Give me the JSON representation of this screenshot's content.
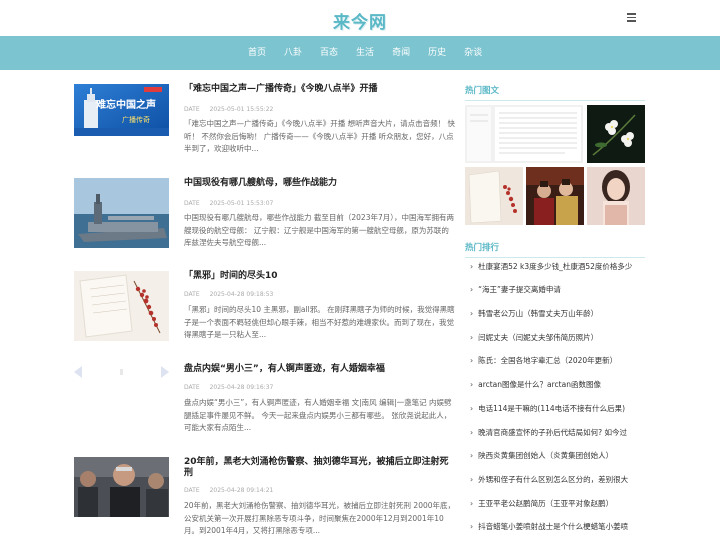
{
  "site": {
    "logo": "来今网"
  },
  "nav": [
    "首页",
    "八卦",
    "百态",
    "生活",
    "奇闻",
    "历史",
    "杂谈"
  ],
  "articles": [
    {
      "title": "「难忘中国之声—广播传奇」《今晚八点半》开播",
      "date_label": "DATE",
      "date": "2025-05-01 15:55:22",
      "desc": "「难忘中国之声—广播传奇」《今晚八点半》开播 想听声音大片，请点击音频！ 快听！ 不然你会后悔哟！ 广播传奇——《今晚八点半》开播 听众朋友，您好，八点半到了，欢迎收听中...",
      "thumb_text": "难忘中国之声 广播传奇"
    },
    {
      "title": "中国现役有哪几艘航母，哪些作战能力",
      "date_label": "DATE",
      "date": "2025-05-01 15:53:07",
      "desc": "中国现役有哪几艘航母，哪些作战能力 截至目前（2023年7月），中国海军拥有两艘现役的航空母舰： 辽宁舰：辽宁舰是中国海军的第一艘航空母舰，原为苏联的库兹涅佐夫号航空母舰..."
    },
    {
      "title": "「黑邪」时间的尽头10",
      "date_label": "DATE",
      "date": "2025-04-28 09:18:53",
      "desc": "「黑邪」时间的尽头10 主黑邪，副all邪。 在刚拜黑瞎子为师的时候，我觉得黑瞎子是一个表面不羁轻佻但却心眼手辣，相当不好惹的难缠家伙。而到了现在，我觉得黑瞎子是一只粘人至..."
    },
    {
      "title": "盘点内娱“男小三”，有人锕声匿迹，有人婚姻幸福",
      "date_label": "DATE",
      "date": "2025-04-28 09:16:37",
      "desc": "盘点内娱“男小三”，有人锕声匿迹，有人婚姻幸福 文|南风 编辑|一盏笔记 内娱劈腿插足事件屡见不鲜。 今天一起来盘点内娱男小三都有哪些。 张欣尧说起此人，可能大家有点陌生..."
    },
    {
      "title": "20年前，黑老大刘涌枪伤警察、抽刘德华耳光，被捕后立即注射死刑",
      "date_label": "DATE",
      "date": "2025-04-28 09:14:21",
      "desc": "20年前，黑老大刘涌枪伤警察、抽刘德华耳光，被捕后立即注射死刑 2000年底，公安机关第一次开展打黑除恶专项斗争，时间聚焦在2000年12月到2001年10月。到2001年4月，又将打黑除恶专项..."
    }
  ],
  "sidebar": {
    "hot_images_title": "热门图文",
    "hot_rank_title": "热门排行",
    "rank": [
      "杜康宴酒52 k3度多少钱_杜康酒52度价格多少",
      "“海王”妻子提交离婚申请",
      "韩雪老公万山（韩雪丈夫万山年龄）",
      "闫妮丈夫（闫妮丈夫邹伟简历照片）",
      "陈氏：全国各地字辈汇总（2020年更新）",
      "arctan图像是什么？arctan函数图像",
      "电话114是干嘛的(114电话不接有什么后果)",
      "晚清官商盛宣怀的子孙后代结局如何? 如今过",
      "陕西炎黄集团创始人（炎黄集团创始人）",
      "外甥和侄子有什么区别怎么区分的，差别很大",
      "王亚平老公赵鹏简历（王亚平对象赵鹏）",
      "抖音蜡笔小姜喷射战士是个什么梗蜡笔小姜喷"
    ]
  },
  "colors": {
    "accent": "#5bb8c6",
    "nav_bg": "#7cc4cf"
  }
}
